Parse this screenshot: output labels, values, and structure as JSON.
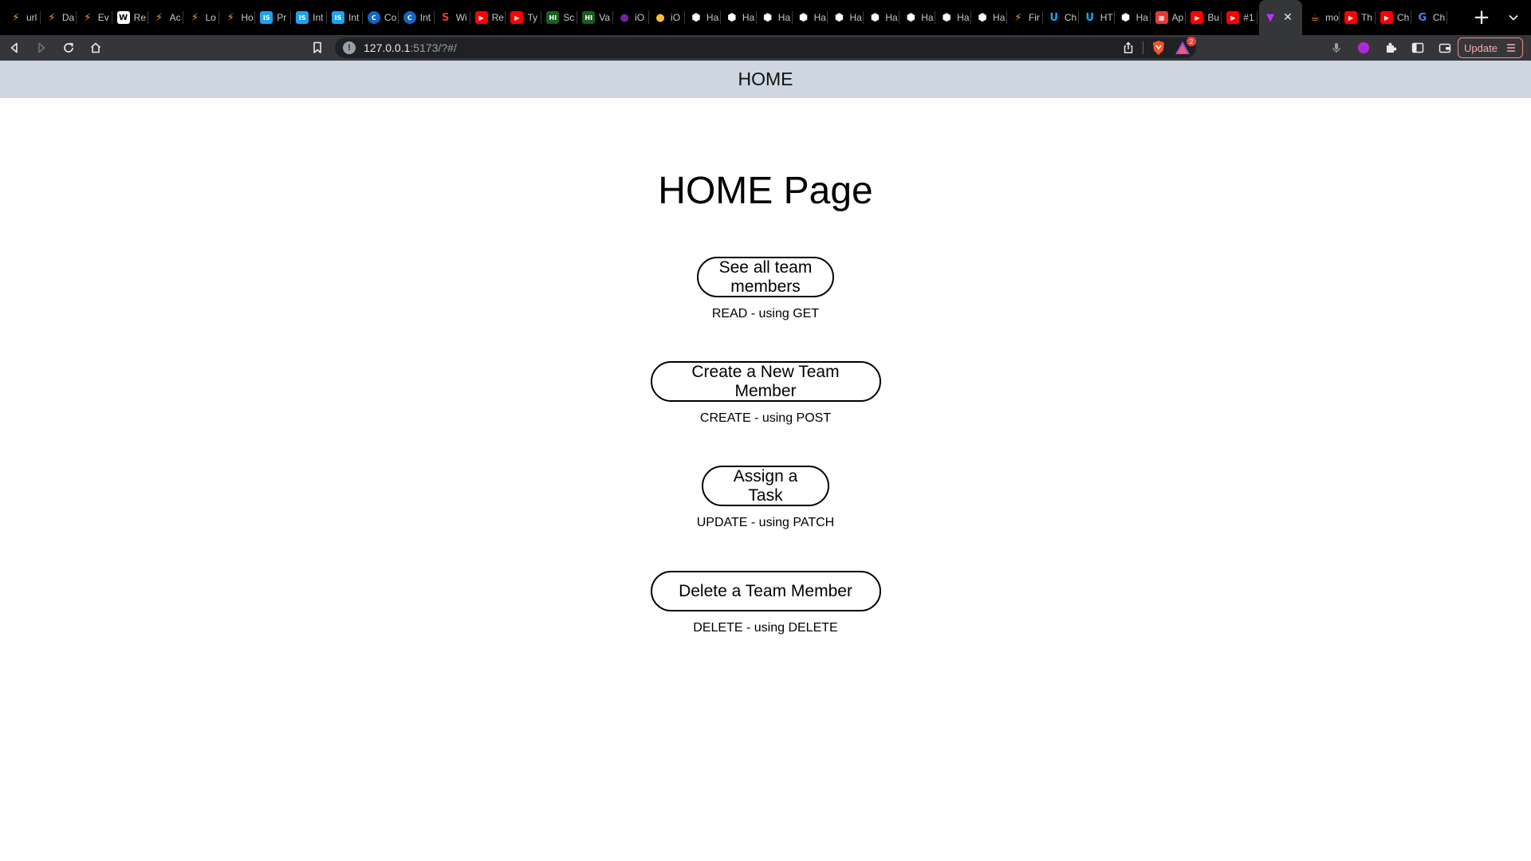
{
  "browser": {
    "tabs": [
      {
        "title": "url",
        "icon": "lightning-icon",
        "color": "#f5a623"
      },
      {
        "title": "Da",
        "icon": "lightning-icon",
        "color": "#f5a623"
      },
      {
        "title": "Ev",
        "icon": "lightning-icon",
        "color": "#f5a623"
      },
      {
        "title": "Re",
        "icon": "wikipedia-icon",
        "color": "#ffffff"
      },
      {
        "title": "Ac",
        "icon": "lightning-icon",
        "color": "#f5a623"
      },
      {
        "title": "Lo",
        "icon": "lightning-icon",
        "color": "#f5a623"
      },
      {
        "title": "Ho",
        "icon": "lightning-icon",
        "color": "#f5a623"
      },
      {
        "title": "Pr",
        "icon": "ist-icon",
        "color": "#1da1f2"
      },
      {
        "title": "Int",
        "icon": "is-icon",
        "color": "#1da1f2"
      },
      {
        "title": "Int",
        "icon": "is-icon",
        "color": "#1da1f2"
      },
      {
        "title": "Co",
        "icon": "c-icon",
        "color": "#1565c0"
      },
      {
        "title": "Int",
        "icon": "c-icon",
        "color": "#1565c0"
      },
      {
        "title": "Wi",
        "icon": "s-icon",
        "color": "#e53935"
      },
      {
        "title": "Re",
        "icon": "youtube-icon",
        "color": "#ff0000"
      },
      {
        "title": "Ty",
        "icon": "youtube-icon",
        "color": "#ff0000"
      },
      {
        "title": "Sc",
        "icon": "hi-icon",
        "color": "#1b5e20"
      },
      {
        "title": "Va",
        "icon": "hi-icon",
        "color": "#1b5e20"
      },
      {
        "title": "iO",
        "icon": "purple-circle-icon",
        "color": "#7b1fa2"
      },
      {
        "title": "iO",
        "icon": "yellow-circle-icon",
        "color": "#fbc02d"
      },
      {
        "title": "Ha",
        "icon": "hex-icon",
        "color": "#ffffff"
      },
      {
        "title": "Ha",
        "icon": "hex-icon",
        "color": "#ffffff"
      },
      {
        "title": "Ha",
        "icon": "hex-icon",
        "color": "#ffffff"
      },
      {
        "title": "Ha",
        "icon": "hex-icon",
        "color": "#ffffff"
      },
      {
        "title": "Ha",
        "icon": "hex-icon",
        "color": "#ffffff"
      },
      {
        "title": "Ha",
        "icon": "hex-icon",
        "color": "#ffffff"
      },
      {
        "title": "Ha",
        "icon": "hex-icon",
        "color": "#ffffff"
      },
      {
        "title": "Ha",
        "icon": "hex-icon",
        "color": "#ffffff"
      },
      {
        "title": "Ha",
        "icon": "hex-icon",
        "color": "#ffffff"
      },
      {
        "title": "Fir",
        "icon": "lightning-icon",
        "color": "#f5a623"
      },
      {
        "title": "Ch",
        "icon": "u-icon",
        "color": "#00b0ff"
      },
      {
        "title": "HT",
        "icon": "u-icon",
        "color": "#00b0ff"
      },
      {
        "title": "Ha",
        "icon": "hex-icon",
        "color": "#ffffff"
      },
      {
        "title": "Ap",
        "icon": "grid-icon",
        "color": "#e53935"
      },
      {
        "title": "Bu",
        "icon": "youtube-icon",
        "color": "#ff0000"
      },
      {
        "title": "#1",
        "icon": "youtube-icon",
        "color": "#ff0000"
      },
      {
        "title": "",
        "icon": "vite-icon",
        "color": "#bd34fe",
        "active": true
      },
      {
        "title": "mo",
        "icon": "java-icon",
        "color": "#f89820"
      },
      {
        "title": "Th",
        "icon": "youtube-icon",
        "color": "#ff0000"
      },
      {
        "title": "Ch",
        "icon": "youtube-icon",
        "color": "#ff0000"
      },
      {
        "title": "Ch",
        "icon": "google-icon",
        "color": "#4285f4"
      }
    ],
    "url": {
      "host": "127.0.0.1",
      "path": ":5173/?#/"
    },
    "rewards_badge": "2",
    "update_label": "Update"
  },
  "app": {
    "header": "HOME",
    "page_title": "HOME Page",
    "actions": [
      {
        "label": "See all team members",
        "caption": "READ - using GET"
      },
      {
        "label": "Create a New Team Member",
        "caption": "CREATE - using POST"
      },
      {
        "label": "Assign a Task",
        "caption": "UPDATE - using PATCH"
      },
      {
        "label": "Delete a Team Member",
        "caption": "DELETE - using DELETE"
      }
    ]
  }
}
